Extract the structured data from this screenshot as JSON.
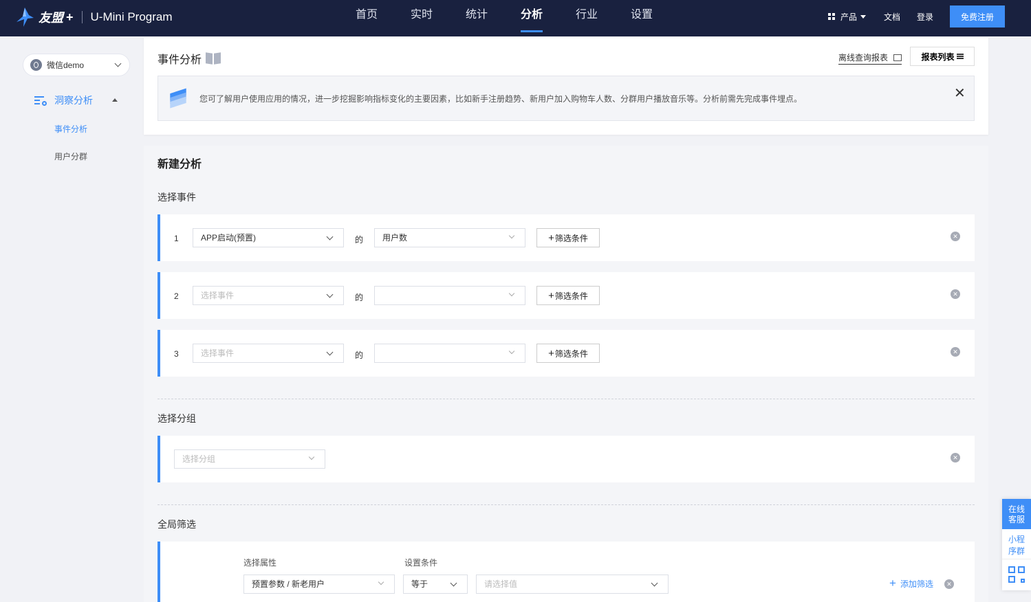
{
  "header": {
    "brand": "友盟",
    "brand_plus": "+",
    "product": "U-Mini Program",
    "nav": [
      "首页",
      "实时",
      "统计",
      "分析",
      "行业",
      "设置"
    ],
    "active_nav": "分析",
    "products_label": "产品",
    "docs_label": "文档",
    "login_label": "登录",
    "signup_label": "免费注册"
  },
  "sidebar": {
    "app_name": "微信demo",
    "group_label": "洞察分析",
    "items": [
      "事件分析",
      "用户分群"
    ],
    "active_item": "事件分析"
  },
  "top_card": {
    "title": "事件分析",
    "offline_label": "离线查询报表",
    "report_list_label": "报表列表",
    "info_text": "您可了解用户使用应用的情况，进一步挖掘影响指标变化的主要因素，比如新手注册趋势、新用户加入购物车人数、分群用户播放音乐等。分析前需先完成事件埋点。"
  },
  "main": {
    "new_analysis_title": "新建分析",
    "select_event_label": "选择事件",
    "of_text": "的",
    "filter_btn_label": "筛选条件",
    "event_rows": [
      {
        "num": "1",
        "event": "APP启动(预置)",
        "metric": "用户数"
      },
      {
        "num": "2",
        "event": "",
        "metric": ""
      },
      {
        "num": "3",
        "event": "",
        "metric": ""
      }
    ],
    "event_placeholder": "选择事件",
    "group_label": "选择分组",
    "group_placeholder": "选择分组",
    "global_filter_label": "全局筛选",
    "attr_label": "选择属性",
    "cond_label": "设置条件",
    "attr_value": "预置参数 / 新老用户",
    "cond_value": "等于",
    "value_placeholder": "请选择值",
    "add_filter_label": "添加筛选"
  },
  "float_widget": {
    "cs_label": "在线客服",
    "mini_label": "小程序群"
  },
  "colors": {
    "nav_bg": "#19213f",
    "accent": "#3e8ef7"
  }
}
